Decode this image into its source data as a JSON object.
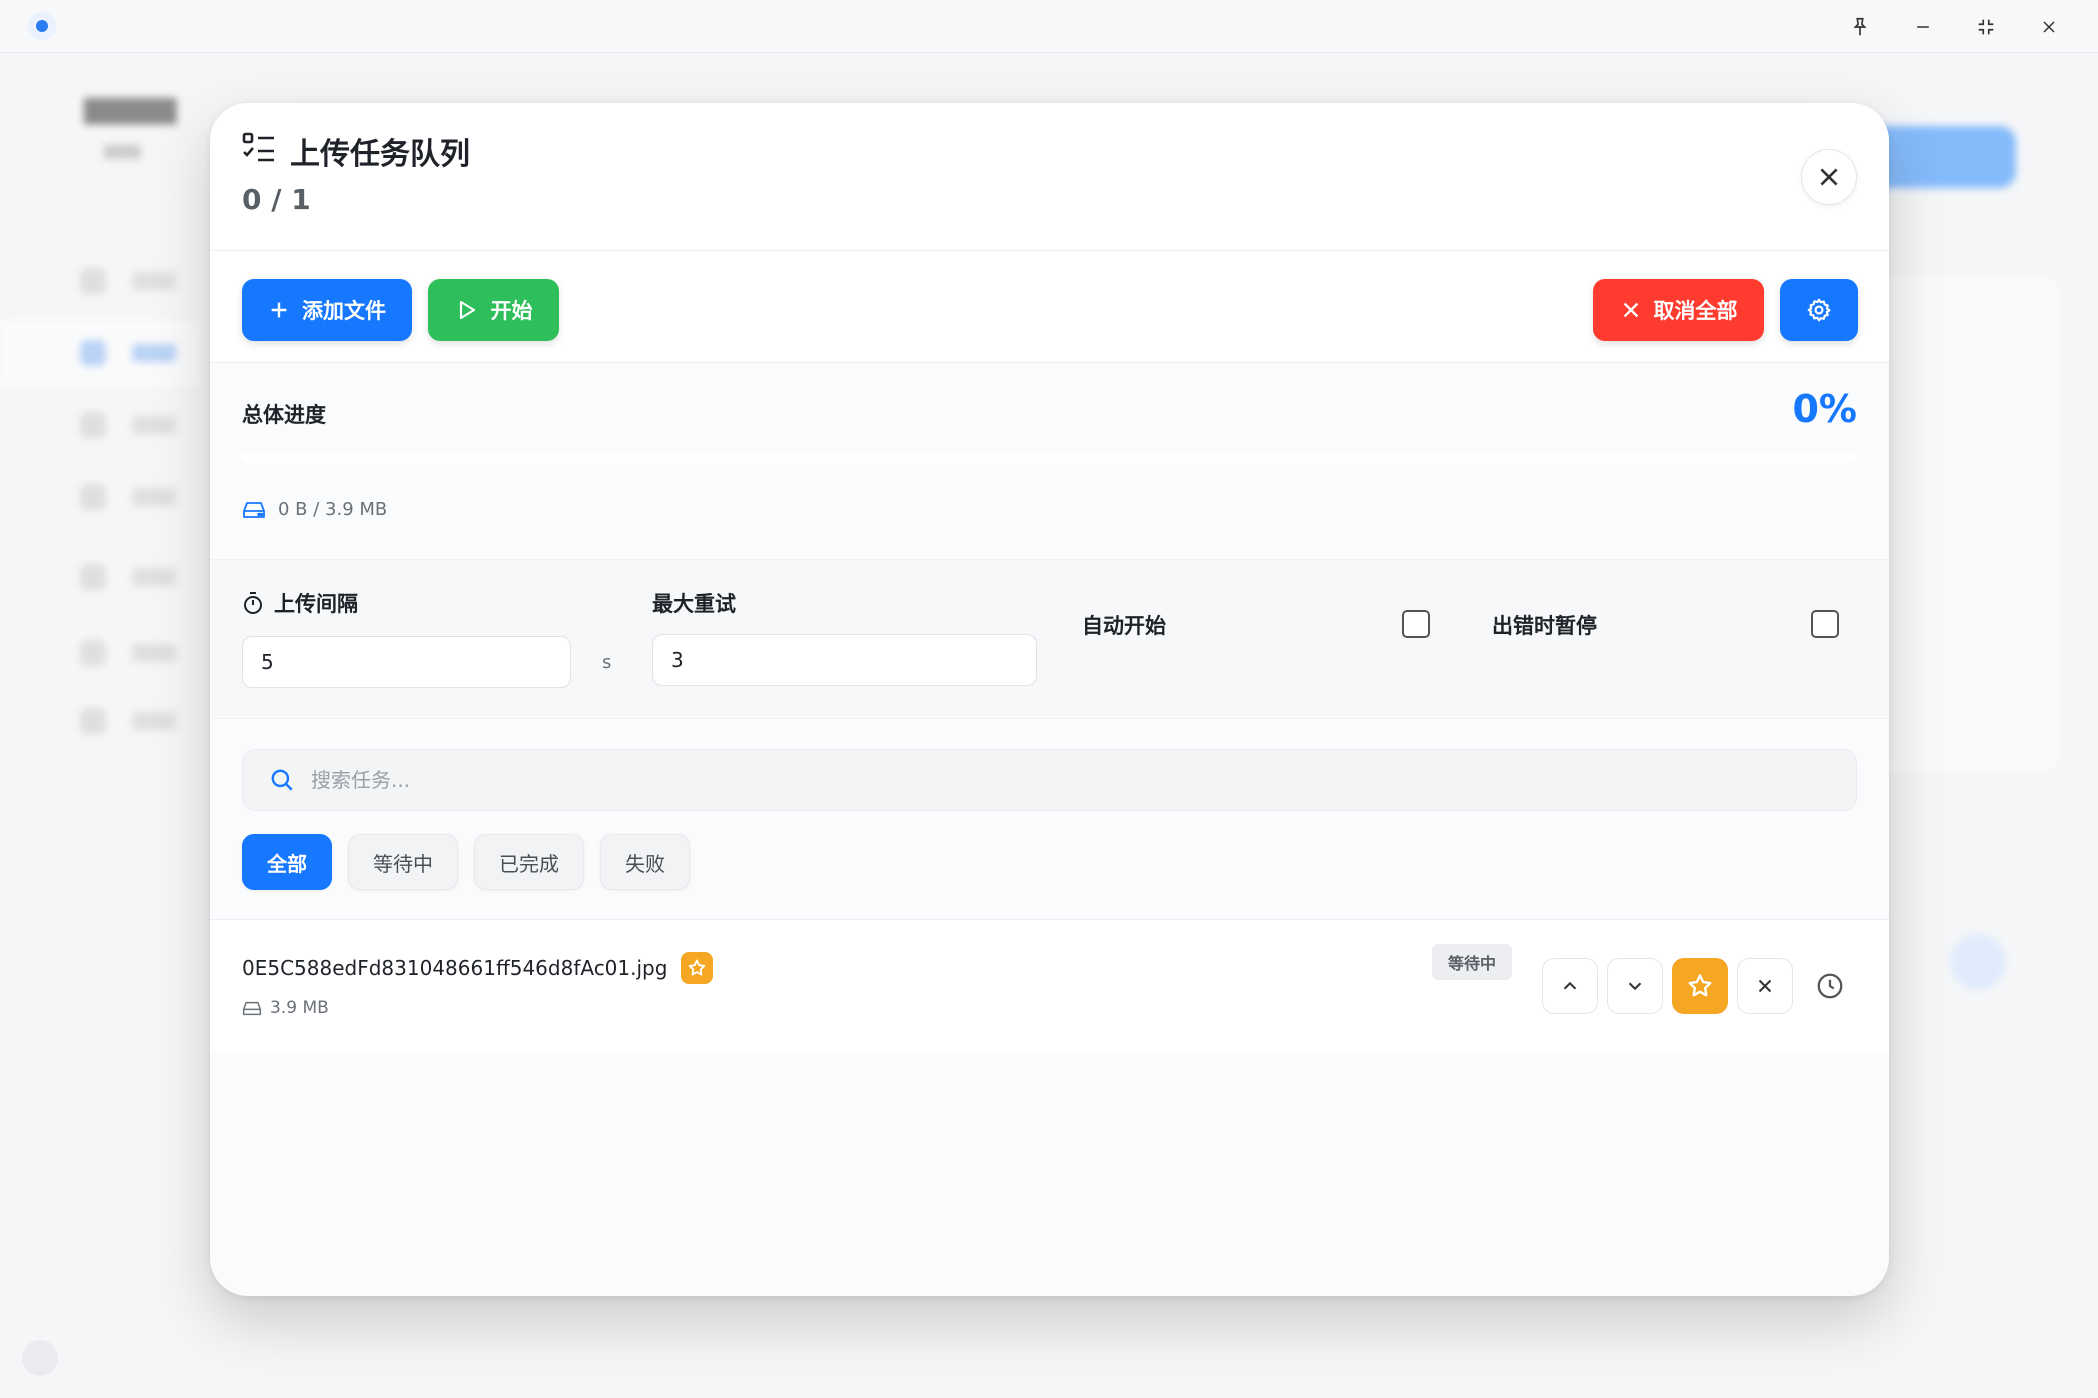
{
  "modal": {
    "title": "上传任务队列",
    "count": "0 / 1"
  },
  "toolbar": {
    "add_label": "添加文件",
    "start_label": "开始",
    "cancel_all_label": "取消全部"
  },
  "progress": {
    "label": "总体进度",
    "percent_text": "0%",
    "percent_value": 0,
    "size_text": "0 B / 3.9 MB"
  },
  "settings": {
    "interval_label": "上传间隔",
    "interval_value": "5",
    "interval_unit": "s",
    "retry_label": "最大重试",
    "retry_value": "3",
    "auto_start_label": "自动开始",
    "auto_start_checked": false,
    "pause_on_error_label": "出错时暂停",
    "pause_on_error_checked": false
  },
  "search": {
    "placeholder": "搜索任务..."
  },
  "filters": [
    {
      "label": "全部",
      "active": true
    },
    {
      "label": "等待中",
      "active": false
    },
    {
      "label": "已完成",
      "active": false
    },
    {
      "label": "失败",
      "active": false
    }
  ],
  "tasks": [
    {
      "name": "0E5C588edFd831048661ff546d8fAc01.jpg",
      "size": "3.9 MB",
      "status": "等待中"
    }
  ],
  "colors": {
    "primary": "#1677ff",
    "success": "#2fbf5a",
    "danger": "#ff3b30",
    "warning": "#f5a623"
  },
  "icons": {
    "title": "task-list-icon",
    "close": "close-icon",
    "add": "plus-icon",
    "start": "play-icon",
    "cancel": "x-icon",
    "settings": "gear-icon",
    "storage": "hard-drive-icon",
    "timer": "stopwatch-icon",
    "search": "search-icon"
  }
}
